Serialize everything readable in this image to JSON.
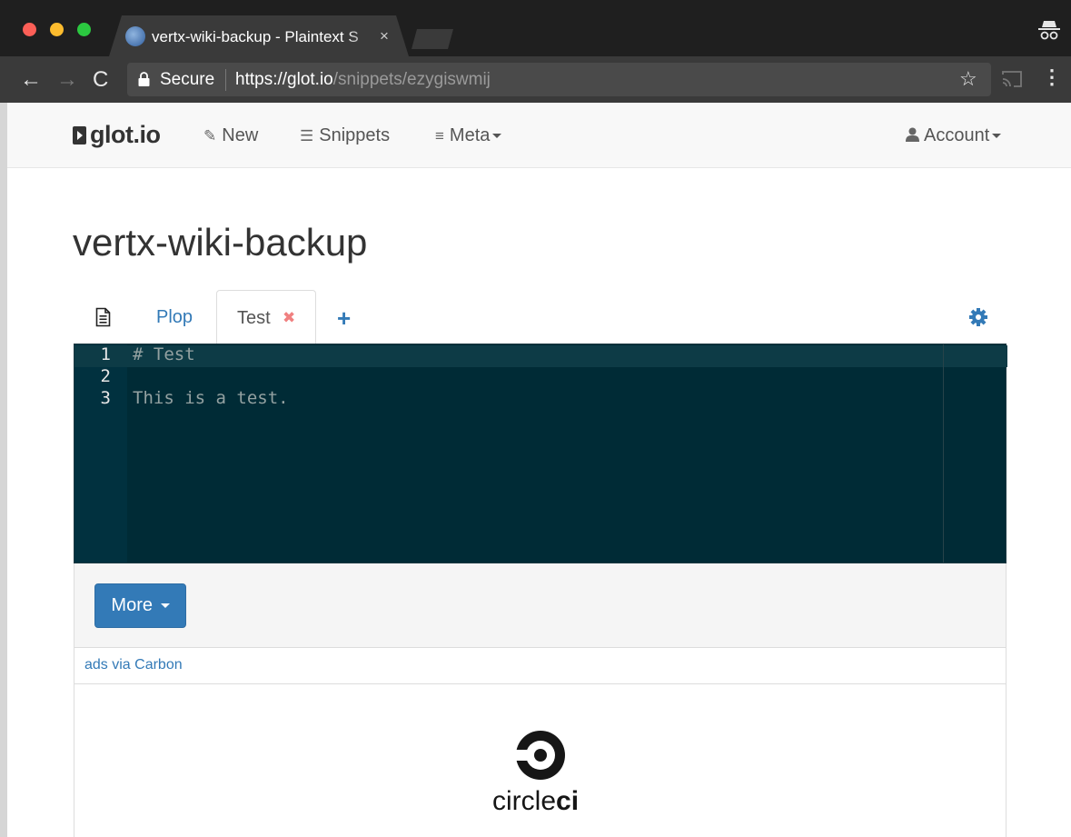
{
  "browser": {
    "tab_title": "vertx-wiki-backup - Plaintext S",
    "tab_close": "×",
    "secure_label": "Secure",
    "url_scheme": "https://",
    "url_host": "glot.io",
    "url_path": "/snippets/ezygiswmij",
    "back": "←",
    "forward": "→",
    "reload": "C",
    "star": "☆",
    "menu": "⋮"
  },
  "site_nav": {
    "brand": "glot.io",
    "new_label": "New",
    "new_icon": "✎",
    "snippets_label": "Snippets",
    "snippets_icon": "☰",
    "meta_label": "Meta",
    "meta_icon": "≡",
    "account_label": "Account"
  },
  "snippet": {
    "title": "vertx-wiki-backup",
    "tabs": [
      {
        "label": "Plop"
      },
      {
        "label": "Test",
        "close": "✖"
      }
    ],
    "add_tab": "+"
  },
  "editor": {
    "lines": [
      {
        "number": "1",
        "text": "# Test"
      },
      {
        "number": "2",
        "text": ""
      },
      {
        "number": "3",
        "text": "This is a test."
      }
    ]
  },
  "footer": {
    "more_label": "More"
  },
  "ads": {
    "link_label": "ads via Carbon",
    "sponsor_text_light": "circle",
    "sponsor_text_bold": "ci"
  }
}
